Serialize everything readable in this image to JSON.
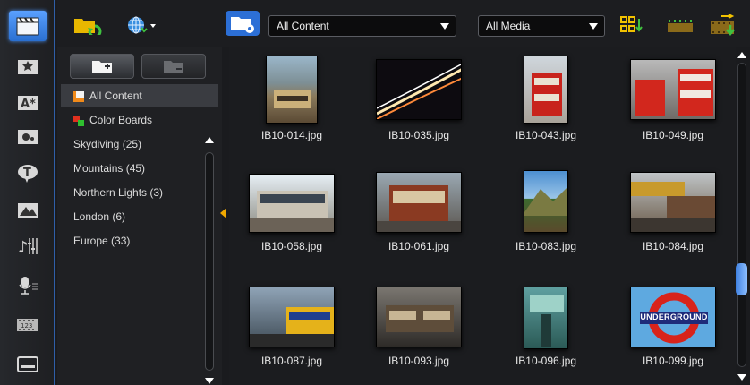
{
  "toolbar": {
    "content_filter": "All Content",
    "media_filter": "All Media"
  },
  "library": {
    "items": [
      {
        "label": "All Content",
        "selected": true,
        "icon": "media-library-icon"
      },
      {
        "label": "Color Boards",
        "selected": false,
        "icon": "color-board-icon"
      },
      {
        "label": "Skydiving  (25)",
        "selected": false
      },
      {
        "label": "Mountains  (45)",
        "selected": false
      },
      {
        "label": "Northern Lights  (3)",
        "selected": false
      },
      {
        "label": "London  (6)",
        "selected": false
      },
      {
        "label": "Europe  (33)",
        "selected": false
      }
    ]
  },
  "gallery": {
    "items": [
      {
        "file": "IB10-014.jpg"
      },
      {
        "file": "IB10-035.jpg"
      },
      {
        "file": "IB10-043.jpg"
      },
      {
        "file": "IB10-049.jpg"
      },
      {
        "file": "IB10-058.jpg"
      },
      {
        "file": "IB10-061.jpg"
      },
      {
        "file": "IB10-083.jpg"
      },
      {
        "file": "IB10-084.jpg"
      },
      {
        "file": "IB10-087.jpg"
      },
      {
        "file": "IB10-093.jpg"
      },
      {
        "file": "IB10-096.jpg"
      },
      {
        "file": "IB10-099.jpg",
        "sign_text": "UNDERGROUND"
      }
    ]
  },
  "colors": {
    "accent": "#2f6fd0",
    "selection": "#3a3c41",
    "collapse_tab": "#f0a800"
  }
}
